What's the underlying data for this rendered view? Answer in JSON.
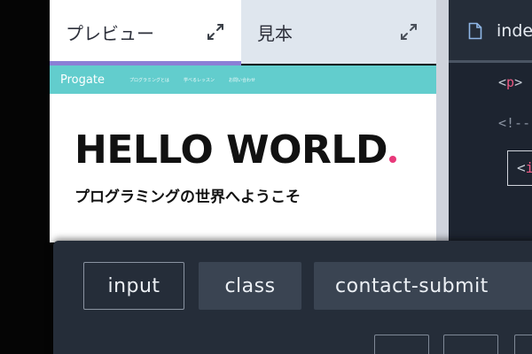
{
  "tabs": {
    "preview_label": "プレビュー",
    "sample_label": "見本"
  },
  "site": {
    "logo": "Progate",
    "nav_links": [
      "プログラミングとは",
      "学べるレッスン",
      "お問い合わせ"
    ],
    "title": "HELLO WORLD",
    "subtitle": "プログラミングの世界へようこそ"
  },
  "editor": {
    "file_name": "index.html",
    "code_line_1_open": "<",
    "code_line_1_tag": "p",
    "code_line_1_rest": ">",
    "code_line_2": "<!--",
    "code_highlight_open": "<",
    "code_highlight_tag": "i"
  },
  "tokens": {
    "input": "input",
    "class": "class",
    "submit": "contact-submit"
  },
  "colors": {
    "accent_purple": "#8b7fd6",
    "site_nav": "#62cdcd",
    "title_dot": "#e8397a",
    "code_tag": "#ef5a84",
    "panel_bg": "#252d39",
    "token_bg": "#3a4452"
  }
}
